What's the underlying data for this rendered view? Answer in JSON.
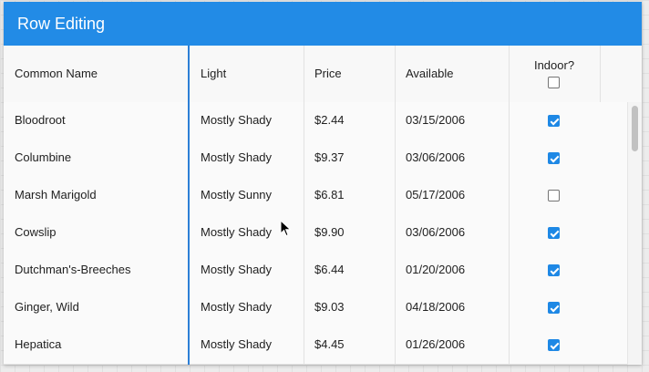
{
  "window": {
    "title": "Row Editing"
  },
  "columns": {
    "common_name": "Common Name",
    "light": "Light",
    "price": "Price",
    "available": "Available",
    "indoor": "Indoor?"
  },
  "header_indoor_checked": false,
  "rows": [
    {
      "common_name": "Bloodroot",
      "light": "Mostly Shady",
      "price": "$2.44",
      "available": "03/15/2006",
      "indoor": true
    },
    {
      "common_name": "Columbine",
      "light": "Mostly Shady",
      "price": "$9.37",
      "available": "03/06/2006",
      "indoor": true
    },
    {
      "common_name": "Marsh Marigold",
      "light": "Mostly Sunny",
      "price": "$6.81",
      "available": "05/17/2006",
      "indoor": false
    },
    {
      "common_name": "Cowslip",
      "light": "Mostly Shady",
      "price": "$9.90",
      "available": "03/06/2006",
      "indoor": true
    },
    {
      "common_name": "Dutchman's-Breeches",
      "light": "Mostly Shady",
      "price": "$6.44",
      "available": "01/20/2006",
      "indoor": true
    },
    {
      "common_name": "Ginger, Wild",
      "light": "Mostly Shady",
      "price": "$9.03",
      "available": "04/18/2006",
      "indoor": true
    },
    {
      "common_name": "Hepatica",
      "light": "Mostly Shady",
      "price": "$4.45",
      "available": "01/26/2006",
      "indoor": true
    }
  ],
  "colors": {
    "accent": "#228be6",
    "checkbox": "#1e88e5",
    "frozen_separator": "#2d7fd6"
  }
}
